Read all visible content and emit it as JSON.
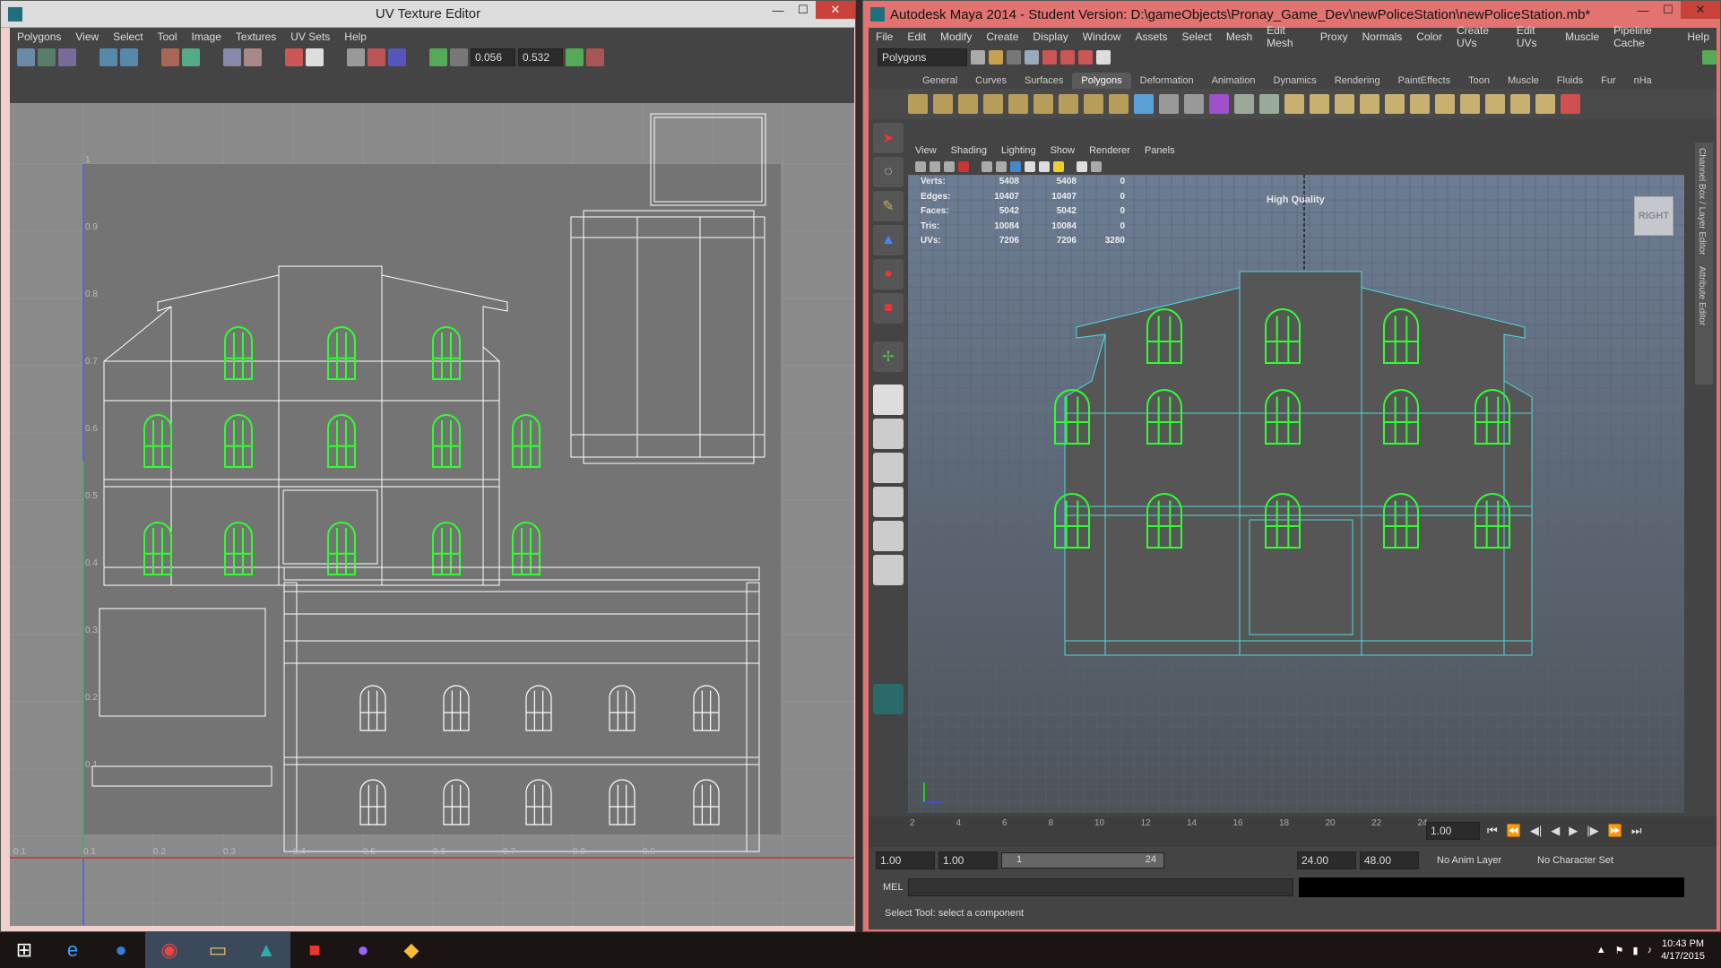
{
  "uv": {
    "title": "UV Texture Editor",
    "menu": [
      "Polygons",
      "View",
      "Select",
      "Tool",
      "Image",
      "Textures",
      "UV Sets",
      "Help"
    ],
    "u_value": "0.056",
    "v_value": "0.532",
    "tick_labels_v": [
      "1",
      "0.9",
      "0.8",
      "0.7",
      "0.6",
      "0.5",
      "0.4",
      "0.3",
      "0.2",
      "0.1"
    ],
    "tick_labels_u": [
      "0.1",
      "0.1",
      "0.2",
      "0.3",
      "0.4",
      "0.5",
      "0.6",
      "0.7",
      "0.8",
      "0.9"
    ]
  },
  "maya": {
    "title": "Autodesk Maya 2014 - Student Version: D:\\gameObjects\\Pronay_Game_Dev\\newPoliceStation\\newPoliceStation.mb*",
    "menu": [
      "File",
      "Edit",
      "Modify",
      "Create",
      "Display",
      "Window",
      "Assets",
      "Select",
      "Mesh",
      "Edit Mesh",
      "Proxy",
      "Normals",
      "Color",
      "Create UVs",
      "Edit UVs",
      "Muscle",
      "Pipeline Cache",
      "Help"
    ],
    "menu_set": "Polygons",
    "shelf_tabs": [
      "General",
      "Curves",
      "Surfaces",
      "Polygons",
      "Deformation",
      "Animation",
      "Dynamics",
      "Rendering",
      "PaintEffects",
      "Toon",
      "Muscle",
      "Fluids",
      "Fur",
      "nHa"
    ],
    "active_tab": "Polygons",
    "panel_menu": [
      "View",
      "Shading",
      "Lighting",
      "Show",
      "Renderer",
      "Panels"
    ],
    "hud": {
      "rows": [
        {
          "label": "Verts:",
          "a": "5408",
          "b": "5408",
          "c": "0"
        },
        {
          "label": "Edges:",
          "a": "10407",
          "b": "10407",
          "c": "0"
        },
        {
          "label": "Faces:",
          "a": "5042",
          "b": "5042",
          "c": "0"
        },
        {
          "label": "Tris:",
          "a": "10084",
          "b": "10084",
          "c": "0"
        },
        {
          "label": "UVs:",
          "a": "7206",
          "b": "7206",
          "c": "3280"
        }
      ],
      "quality": "High Quality",
      "view_cube": "RIGHT"
    },
    "timeline_ticks": [
      "2",
      "4",
      "6",
      "8",
      "10",
      "12",
      "14",
      "16",
      "18",
      "20",
      "22",
      "24"
    ],
    "current_frame": "1.00",
    "range": {
      "start": "1.00",
      "start2": "1.00",
      "slider_start": "1",
      "slider_end": "24",
      "end": "24.00",
      "end2": "48.00"
    },
    "anim_layer": "No Anim Layer",
    "char_set": "No Character Set",
    "cmd_label": "MEL",
    "help_line": "Select Tool: select a component",
    "side_tabs": [
      "Channel Box / Layer Editor",
      "Attribute Editor"
    ]
  },
  "taskbar": {
    "time": "10:43 PM",
    "date": "4/17/2015"
  }
}
